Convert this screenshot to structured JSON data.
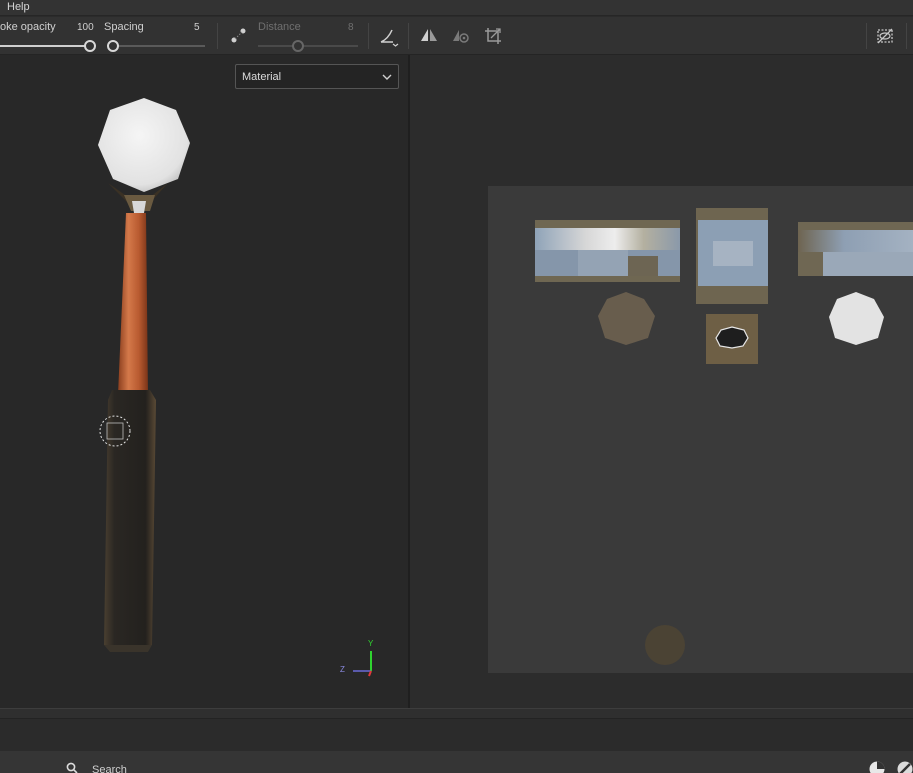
{
  "menu": {
    "help": "Help"
  },
  "toolbar": {
    "stroke_opacity_label": "oke opacity",
    "stroke_opacity_value": "100",
    "stroke_opacity_level": 1.0,
    "spacing_label": "Spacing",
    "spacing_value": "5",
    "spacing_level": 0.0,
    "distance_label": "Distance",
    "distance_value": "8",
    "distance_level": 0.4
  },
  "viewport3d": {
    "channel_dropdown": "Material",
    "axis_y": "Y",
    "axis_z": "Z"
  },
  "search": {
    "label": "Search"
  },
  "colors": {
    "accent": "#cfcfcf",
    "handle_orange": "#c46a3c",
    "grip_dark": "#2a2622",
    "head_white": "#e8e8e8",
    "axis_green": "#2fd32f",
    "axis_red": "#e03a3a",
    "axis_blue": "#6a6ad8"
  }
}
